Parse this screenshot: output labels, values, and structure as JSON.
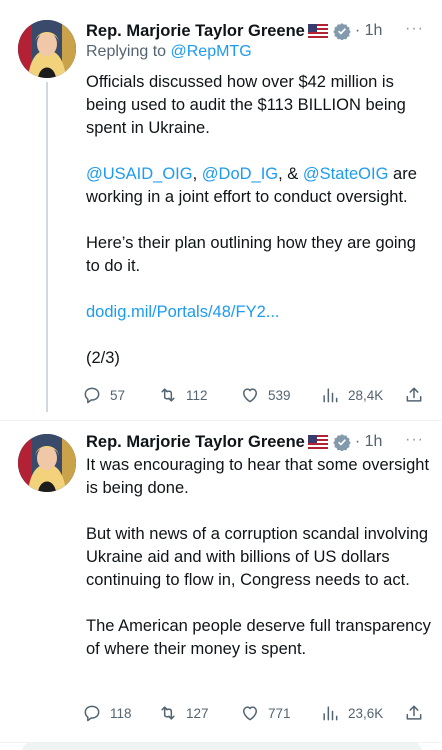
{
  "tweets": [
    {
      "author": "Rep. Marjorie Taylor Greene",
      "time": "1h",
      "replying_prefix": "Replying to",
      "replying_handle": "@RepMTG",
      "p1": "Officials discussed how over $42 million is being used to audit the $113 BILLION being spent in Ukraine.",
      "p2_mention1": "@USAID_OIG",
      "p2_sep1": ", ",
      "p2_mention2": "@DoD_IG",
      "p2_sep2": ", & ",
      "p2_mention3": "@StateOIG",
      "p2_rest": " are working in a joint effort to conduct oversight.",
      "p3": "Here’s their plan outlining how they are going to do it.",
      "link": "dodig.mil/Portals/48/FY2...",
      "p4": "(2/3)",
      "replies": "57",
      "retweets": "112",
      "likes": "539",
      "views": "28,4K"
    },
    {
      "author": "Rep. Marjorie Taylor Greene",
      "time": "1h",
      "p1": "It was encouraging to hear that some oversight is being done.",
      "p2": "But with news of a corruption scandal involving Ukraine aid and with billions of US dollars continuing to flow in, Congress needs to act.",
      "p3": "The American people deserve full transparency of where their money is spent.",
      "replies": "118",
      "retweets": "127",
      "likes": "771",
      "views": "23,6K"
    }
  ],
  "more_label": "···",
  "icons": {
    "reply": "reply-icon",
    "retweet": "retweet-icon",
    "like": "heart-icon",
    "views": "views-icon",
    "share": "share-icon",
    "verified": "verified-badge-icon",
    "flag": "us-flag-icon"
  },
  "colors": {
    "link": "#1d9bf0",
    "secondary": "#536471",
    "text": "#0f1419"
  }
}
